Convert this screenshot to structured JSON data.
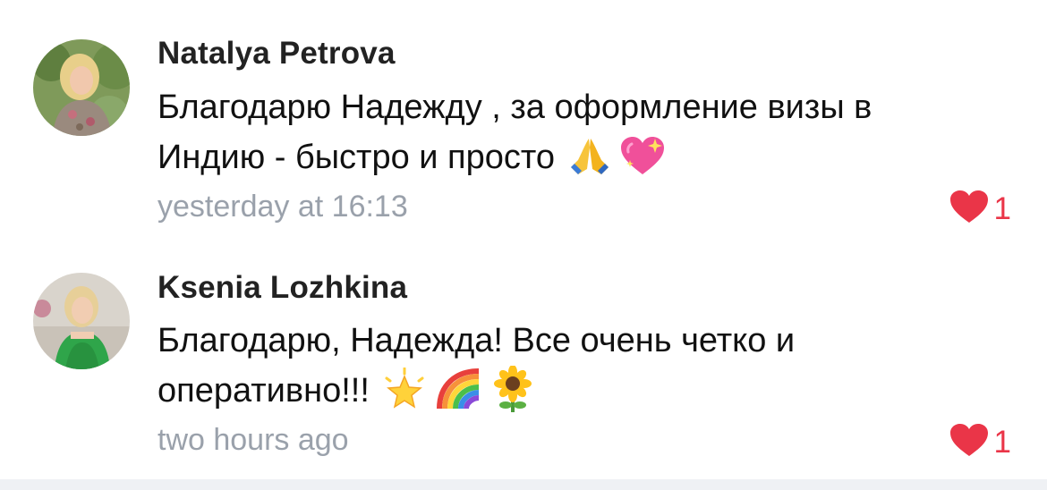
{
  "comments": [
    {
      "author": "Natalya Petrova",
      "text_line1": "Благодарю Надежду , за оформление визы в",
      "text_line2": "Индию - быстро и просто",
      "emojis": [
        "folded-hands-emoji",
        "sparkling-heart-emoji"
      ],
      "timestamp": "yesterday at 16:13",
      "likes": "1"
    },
    {
      "author": "Ksenia Lozhkina",
      "text_line1": "Благодарю, Надежда! Все очень четко и",
      "text_line2": "оперативно!!!",
      "emojis": [
        "glowing-star-emoji",
        "rainbow-emoji",
        "sunflower-emoji"
      ],
      "timestamp": "two hours ago",
      "likes": "1"
    }
  ],
  "colors": {
    "like_red": "#ea3548",
    "timestamp_gray": "#9aa1ab",
    "footer_bg": "#eff1f4"
  }
}
